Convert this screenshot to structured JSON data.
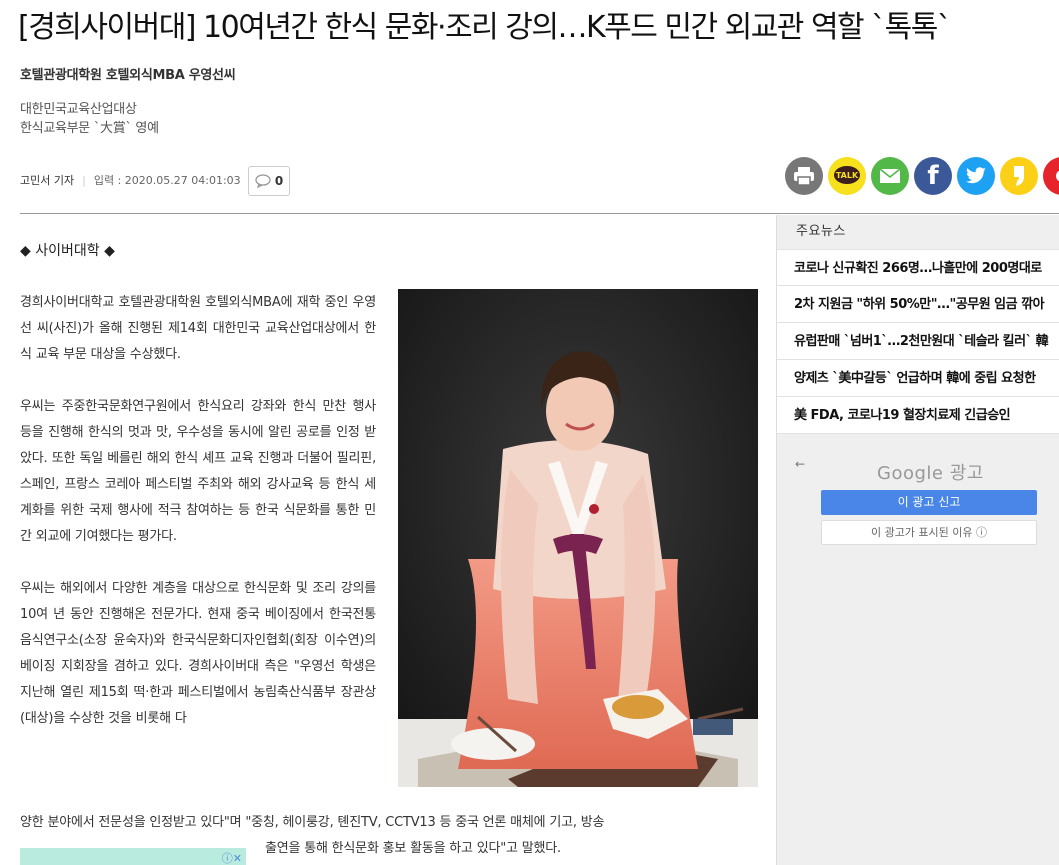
{
  "article": {
    "headline": "[경희사이버대] 10여년간 한식 문화·조리 강의…K푸드 민간 외교관 역할 `톡톡`",
    "subtitle": "호텔관광대학원 호텔외식MBA 우영선씨",
    "sub_lines": [
      "대한민국교육산업대상",
      "한식교육부문 `大賞` 영예"
    ],
    "reporter": "고민서 기자",
    "date_label": "입력 : 2020.05.27 04:01:03",
    "comment_count": "0",
    "section_tag": "◆ 사이버대학 ◆",
    "paragraphs": [
      "경희사이버대학교 호텔관광대학원 호텔외식MBA에 재학 중인 우영선 씨(사진)가 올해 진행된 제14회 대한민국 교육산업대상에서 한식 교육 부문 대상을 수상했다.",
      "우씨는 주중한국문화연구원에서 한식요리 강좌와 한식 만찬 행사 등을 진행해 한식의 멋과 맛, 우수성을 동시에 알린 공로를 인정 받았다. 또한 독일 베를린 해외 한식 셰프 교육 진행과 더불어 필리핀, 스페인, 프랑스 코레아 페스티벌 주최와 해외 강사교육 등 한식 세계화를 위한 국제 행사에 적극 참여하는 등 한국 식문화를 통한 민간 외교에 기여했다는 평가다.",
      "우씨는 해외에서 다양한 계층을 대상으로 한식문화 및 조리 강의를 10여 년 동안 진행해온 전문가다. 현재 중국 베이징에서 한국전통음식연구소(소장 윤숙자)와 한국식문화디자인협회(회장 이수연)의 베이징 지회장을 겸하고 있다. 경희사이버대 측은 \"우영선 학생은 지난해 열린 제15회 떡·한과 페스티벌에서 농림축산식품부 장관상(대상)을 수상한 것을 비롯해 다"
    ],
    "full_line_1": "양한 분야에서 전문성을 인정받고 있다\"며 \"중칭, 헤이룽강, 톈진TV, CCTV13 등 중국 언론 매체에 기고, 방송",
    "full_line_2": "출연을 통해 한식문화 홍보 활동을 하고 있다\"고 말했다."
  },
  "share": {
    "buttons": [
      {
        "name": "print",
        "color": "#777777"
      },
      {
        "name": "kakaotalk",
        "color": "#f7e01c",
        "label": "TALK"
      },
      {
        "name": "email",
        "color": "#52b848"
      },
      {
        "name": "facebook",
        "color": "#3b5998",
        "label": "f"
      },
      {
        "name": "twitter",
        "color": "#1da1f2"
      },
      {
        "name": "kakaostory",
        "color": "#fcd016"
      },
      {
        "name": "more",
        "color": "#e5242b"
      }
    ]
  },
  "sidebar": {
    "heading": "주요뉴스",
    "items": [
      "코로나 신규확진 266명…나흘만에 200명대로",
      "2차 지원금 \"하위 50%만\"…\"공무원 임금 깎아",
      "유럽판매 `넘버1`…2천만원대 `테슬라 킬러` 韓",
      "양제츠 `美中갈등` 언급하며 韓에 중립 요청한",
      "美 FDA, 코로나19 혈장치료제 긴급승인"
    ]
  },
  "ad": {
    "back_arrow": "←",
    "brand": "Google 광고",
    "report_label": "이 광고 신고",
    "why_label": "이 광고가 표시된 이유 ⓘ",
    "strip_icon": "ⓘ✕"
  }
}
